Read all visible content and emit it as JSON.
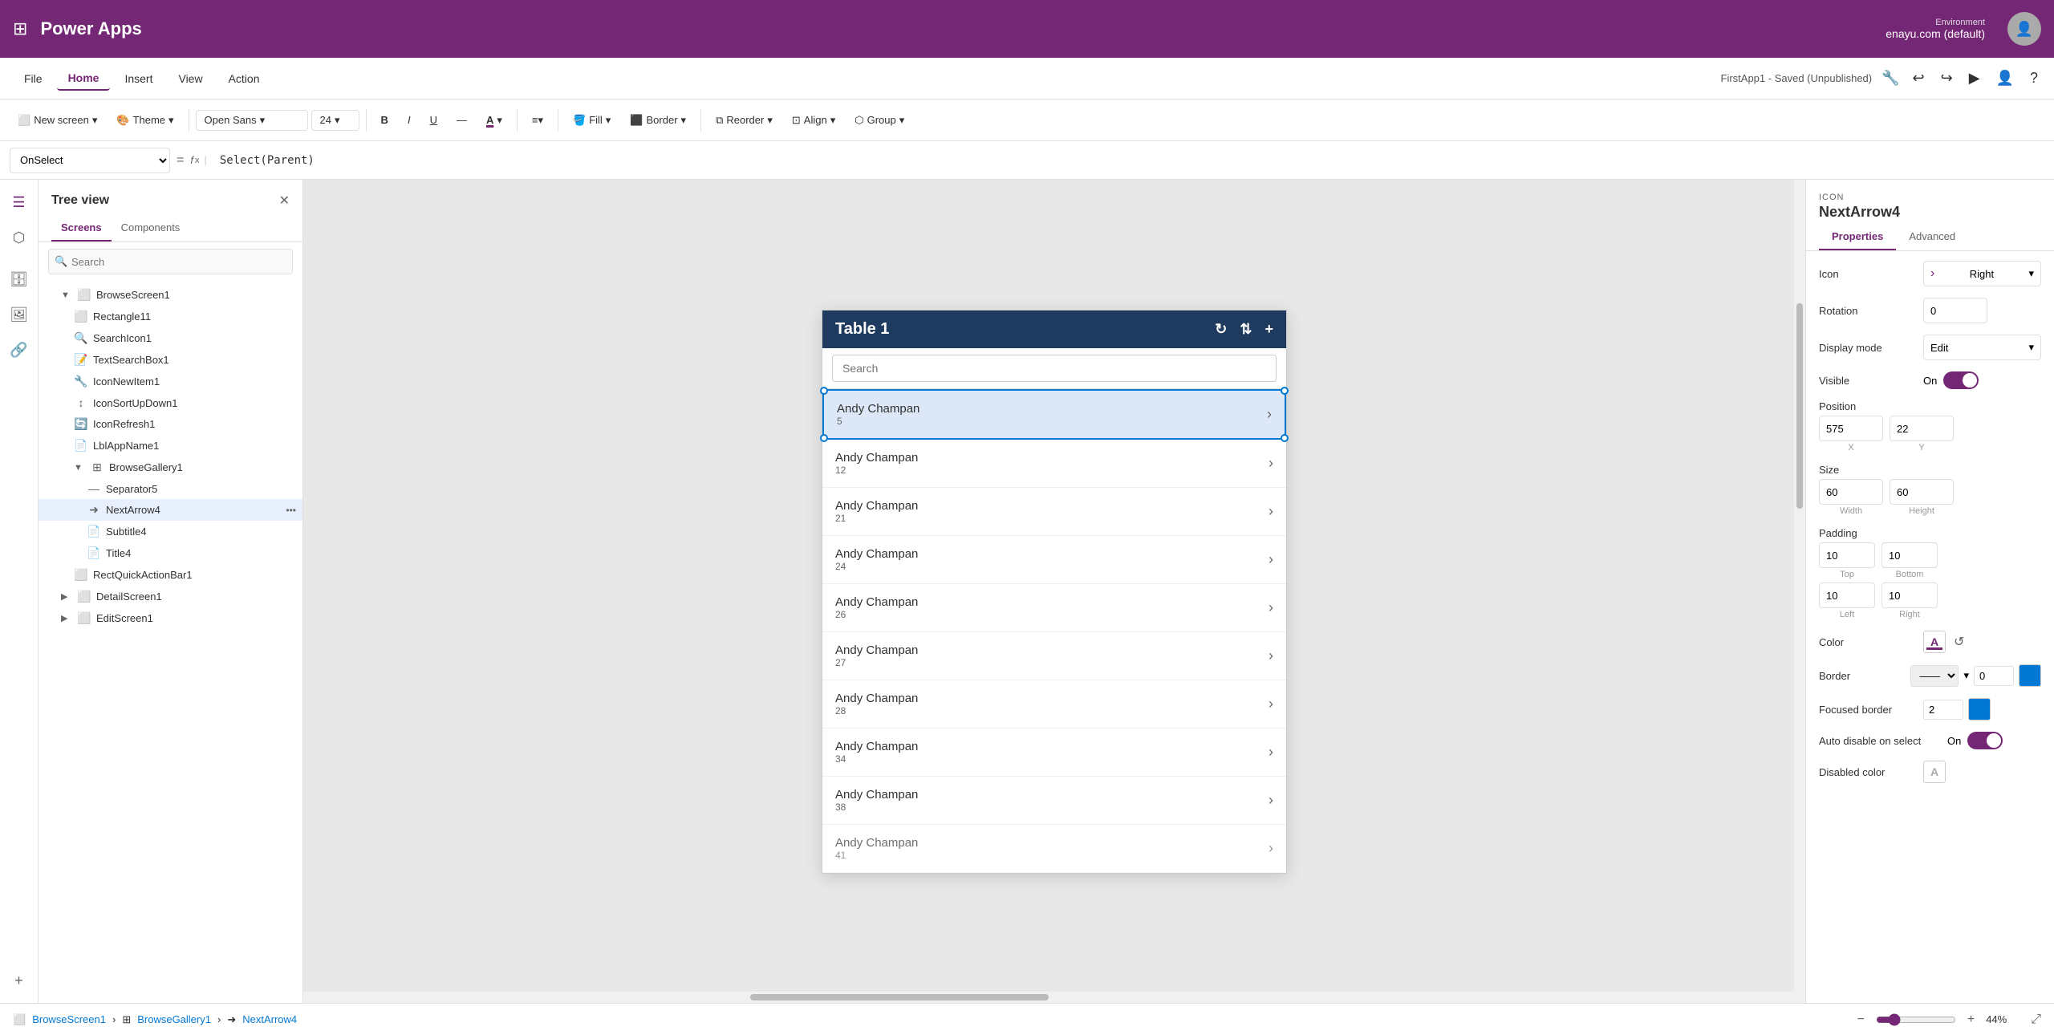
{
  "app": {
    "title": "Power Apps",
    "saved_status": "FirstApp1 - Saved (Unpublished)",
    "environment_label": "Environment",
    "environment_name": "enayu.com (default)"
  },
  "menubar": {
    "file": "File",
    "home": "Home",
    "insert": "Insert",
    "view": "View",
    "action": "Action"
  },
  "toolbar": {
    "new_screen": "New screen",
    "theme": "Theme",
    "font": "Open Sans",
    "font_size": "24",
    "fill": "Fill",
    "border": "Border",
    "reorder": "Reorder",
    "align": "Align",
    "group": "Group"
  },
  "formulabar": {
    "property": "OnSelect",
    "formula": "Select(Parent)"
  },
  "tree_panel": {
    "title": "Tree view",
    "tabs": [
      "Screens",
      "Components"
    ],
    "search_placeholder": "Search",
    "items": [
      {
        "id": "Rectangle11",
        "label": "Rectangle11",
        "type": "rect",
        "indent": 2
      },
      {
        "id": "SearchIcon1",
        "label": "SearchIcon1",
        "type": "icon",
        "indent": 2
      },
      {
        "id": "TextSearchBox1",
        "label": "TextSearchBox1",
        "type": "text",
        "indent": 2
      },
      {
        "id": "IconNewItem1",
        "label": "IconNewItem1",
        "type": "icon",
        "indent": 2
      },
      {
        "id": "IconSortUpDown1",
        "label": "IconSortUpDown1",
        "type": "icon",
        "indent": 2
      },
      {
        "id": "IconRefresh1",
        "label": "IconRefresh1",
        "type": "icon",
        "indent": 2
      },
      {
        "id": "LblAppName1",
        "label": "LblAppName1",
        "type": "label",
        "indent": 2
      },
      {
        "id": "BrowseGallery1",
        "label": "BrowseGallery1",
        "type": "gallery",
        "indent": 2,
        "expanded": true
      },
      {
        "id": "Separator5",
        "label": "Separator5",
        "type": "separator",
        "indent": 3
      },
      {
        "id": "NextArrow4",
        "label": "NextArrow4",
        "type": "icon",
        "indent": 3,
        "selected": true
      },
      {
        "id": "Subtitle4",
        "label": "Subtitle4",
        "type": "label",
        "indent": 3
      },
      {
        "id": "Title4",
        "label": "Title4",
        "type": "label",
        "indent": 3
      },
      {
        "id": "RectQuickActionBar1",
        "label": "RectQuickActionBar1",
        "type": "rect",
        "indent": 2
      },
      {
        "id": "DetailScreen1",
        "label": "DetailScreen1",
        "type": "screen",
        "indent": 1
      },
      {
        "id": "EditScreen1",
        "label": "EditScreen1",
        "type": "screen",
        "indent": 1
      }
    ]
  },
  "canvas": {
    "browse_header": "Table 1",
    "gallery_items": [
      {
        "name": "Andy Champan",
        "num": "5",
        "selected": true
      },
      {
        "name": "Andy Champan",
        "num": "12",
        "selected": false
      },
      {
        "name": "Andy Champan",
        "num": "21",
        "selected": false
      },
      {
        "name": "Andy Champan",
        "num": "24",
        "selected": false
      },
      {
        "name": "Andy Champan",
        "num": "26",
        "selected": false
      },
      {
        "name": "Andy Champan",
        "num": "27",
        "selected": false
      },
      {
        "name": "Andy Champan",
        "num": "28",
        "selected": false
      },
      {
        "name": "Andy Champan",
        "num": "34",
        "selected": false
      },
      {
        "name": "Andy Champan",
        "num": "38",
        "selected": false
      },
      {
        "name": "Andy Champan",
        "num": "41",
        "selected": false
      }
    ]
  },
  "right_panel": {
    "icon_label": "ICON",
    "element_name": "NextArrow4",
    "tabs": [
      "Properties",
      "Advanced"
    ],
    "props": {
      "icon_label": "Icon",
      "icon_value": "Right",
      "rotation_label": "Rotation",
      "rotation_value": "0",
      "display_mode_label": "Display mode",
      "display_mode_value": "Edit",
      "visible_label": "Visible",
      "visible_value": "On",
      "position_label": "Position",
      "position_x": "575",
      "position_y": "22",
      "x_label": "X",
      "y_label": "Y",
      "size_label": "Size",
      "size_width": "60",
      "size_height": "60",
      "width_label": "Width",
      "height_label": "Height",
      "padding_label": "Padding",
      "padding_top": "10",
      "padding_bottom": "10",
      "padding_left": "10",
      "padding_right": "10",
      "top_label": "Top",
      "bottom_label": "Bottom",
      "left_label": "Left",
      "right_label": "Right",
      "color_label": "Color",
      "border_label": "Border",
      "border_width": "0",
      "focused_border_label": "Focused border",
      "focused_border_width": "2",
      "auto_disable_label": "Auto disable on select",
      "auto_disable_value": "On",
      "disabled_color_label": "Disabled color"
    }
  },
  "statusbar": {
    "breadcrumb_screen": "BrowseScreen1",
    "breadcrumb_gallery": "BrowseGallery1",
    "breadcrumb_item": "NextArrow4",
    "zoom_value": "44",
    "zoom_symbol": "%"
  }
}
